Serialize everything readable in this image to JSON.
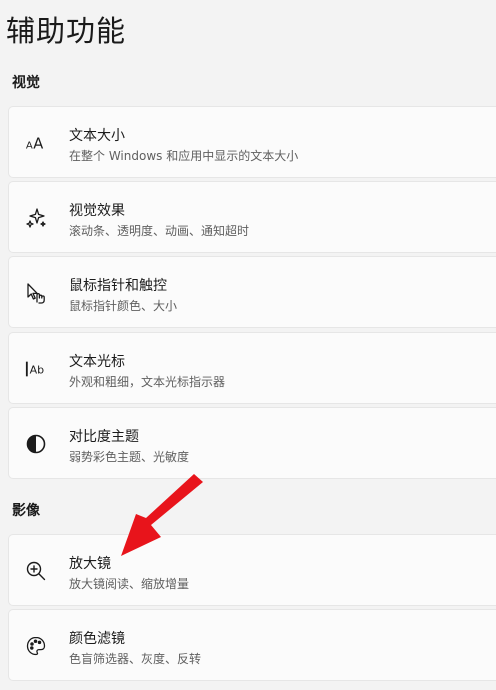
{
  "page": {
    "title": "辅助功能"
  },
  "sections": [
    {
      "title": "视觉",
      "items": [
        {
          "icon": "text-size-icon",
          "title": "文本大小",
          "subtitle": "在整个 Windows 和应用中显示的文本大小"
        },
        {
          "icon": "sparkle-icon",
          "title": "视觉效果",
          "subtitle": "滚动条、透明度、动画、通知超时"
        },
        {
          "icon": "pointer-touch-icon",
          "title": "鼠标指针和触控",
          "subtitle": "鼠标指针颜色、大小"
        },
        {
          "icon": "text-cursor-icon",
          "title": "文本光标",
          "subtitle": "外观和粗细，文本光标指示器"
        },
        {
          "icon": "contrast-icon",
          "title": "对比度主题",
          "subtitle": "弱势彩色主题、光敏度"
        }
      ]
    },
    {
      "title": "影像",
      "items": [
        {
          "icon": "magnifier-icon",
          "title": "放大镜",
          "subtitle": "放大镜阅读、缩放增量"
        },
        {
          "icon": "palette-icon",
          "title": "颜色滤镜",
          "subtitle": "色盲筛选器、灰度、反转"
        }
      ]
    }
  ],
  "colors": {
    "annotation_arrow": "#e8141b"
  }
}
